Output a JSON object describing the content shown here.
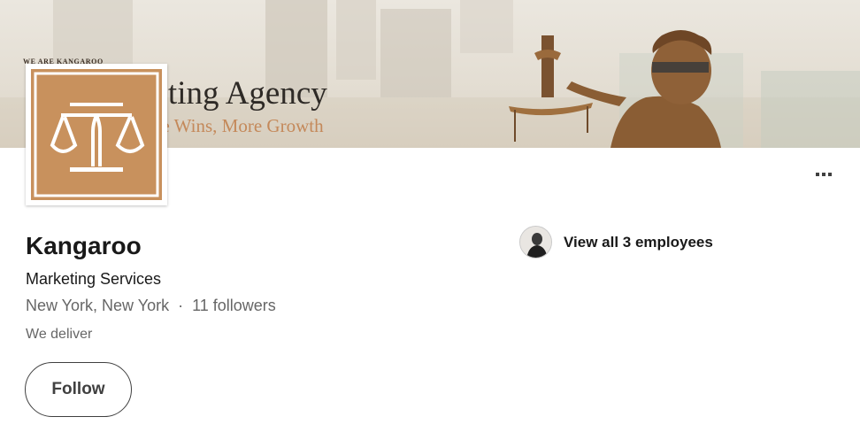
{
  "banner": {
    "small_text": "WE ARE KANGAROO",
    "title": "keting Agency",
    "tagline": "ore Wins, More Growth"
  },
  "company": {
    "name": "Kangaroo",
    "industry": "Marketing Services",
    "location": "New York, New York",
    "separator": "·",
    "followers": "11 followers",
    "tagline": "We deliver"
  },
  "actions": {
    "follow_label": "Follow",
    "employees_label": "View all 3 employees"
  },
  "colors": {
    "brand": "#c8915d",
    "logo_mark": "#ffffff"
  },
  "icons": {
    "logo": "scales-of-justice-logo",
    "more": "more-options-icon"
  }
}
